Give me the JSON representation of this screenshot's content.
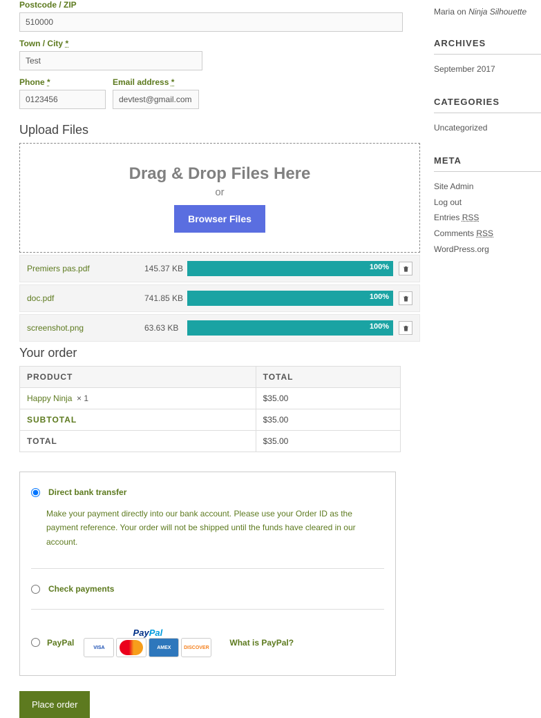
{
  "form": {
    "postcode_label": "Postcode / ZIP",
    "postcode_value": "510000",
    "town_label": "Town / City",
    "town_req": "*",
    "town_value": "Test",
    "phone_label": "Phone",
    "phone_req": "*",
    "phone_value": "0123456",
    "email_label": "Email address",
    "email_req": "*",
    "email_value": "devtest@gmail.com"
  },
  "upload": {
    "title": "Upload Files",
    "drop_text": "Drag & Drop Files Here",
    "or_text": "or",
    "browse_label": "Browser Files",
    "files": [
      {
        "name": "Premiers pas.pdf",
        "size": "145.37 KB",
        "pct": "100%"
      },
      {
        "name": "doc.pdf",
        "size": "741.85 KB",
        "pct": "100%"
      },
      {
        "name": "screenshot.png",
        "size": "63.63 KB",
        "pct": "100%"
      }
    ]
  },
  "order": {
    "title": "Your order",
    "col_product": "PRODUCT",
    "col_total": "TOTAL",
    "product_name": "Happy Ninja",
    "product_qty": "× 1",
    "product_total": "$35.00",
    "subtotal_label": "SUBTOTAL",
    "subtotal_value": "$35.00",
    "total_label": "TOTAL",
    "total_value": "$35.00"
  },
  "payment": {
    "bank_label": "Direct bank transfer",
    "bank_desc": "Make your payment directly into our bank account. Please use your Order ID as the payment reference. Your order will not be shipped until the funds have cleared in our account.",
    "check_label": "Check payments",
    "paypal_label": "PayPal",
    "what_paypal": "What is PayPal?",
    "place_order": "Place order"
  },
  "sidebar": {
    "comment_author": "Maria",
    "comment_on": "on",
    "comment_item": "Ninja Silhouette",
    "archives_title": "ARCHIVES",
    "archives_link": "September 2017",
    "categories_title": "CATEGORIES",
    "categories_link": "Uncategorized",
    "meta_title": "META",
    "meta_links": [
      "Site Admin",
      "Log out",
      "Entries RSS",
      "Comments RSS",
      "WordPress.org"
    ]
  }
}
